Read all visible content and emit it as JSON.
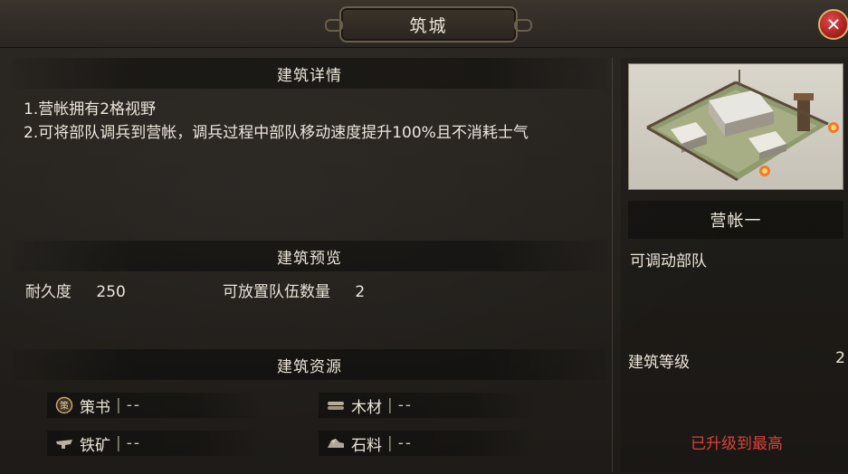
{
  "window": {
    "title": "筑城",
    "close_glyph": "✕"
  },
  "details": {
    "header": "建筑详情",
    "lines": [
      "1.营帐拥有2格视野",
      "2.可将部队调兵到营帐，调兵过程中部队移动速度提升100%且不消耗士气"
    ]
  },
  "preview_section": {
    "header": "建筑预览",
    "durability_label": "耐久度",
    "durability_value": "250",
    "troops_label": "可放置队伍数量",
    "troops_value": "2"
  },
  "resources": {
    "header": "建筑资源",
    "items": [
      {
        "label": "策书",
        "value": "--",
        "icon": "strategy-book-icon"
      },
      {
        "label": "木材",
        "value": "--",
        "icon": "wood-icon"
      },
      {
        "label": "铁矿",
        "value": "--",
        "icon": "iron-ore-icon"
      },
      {
        "label": "石料",
        "value": "--",
        "icon": "stone-icon"
      }
    ]
  },
  "building": {
    "name": "营帐一",
    "description": "可调动部队",
    "level_label": "建筑等级",
    "level_value": "2",
    "status": "已升级到最高"
  },
  "colors": {
    "accent_red": "#d9423a",
    "text": "#ece6da",
    "background": "#221f1b"
  }
}
